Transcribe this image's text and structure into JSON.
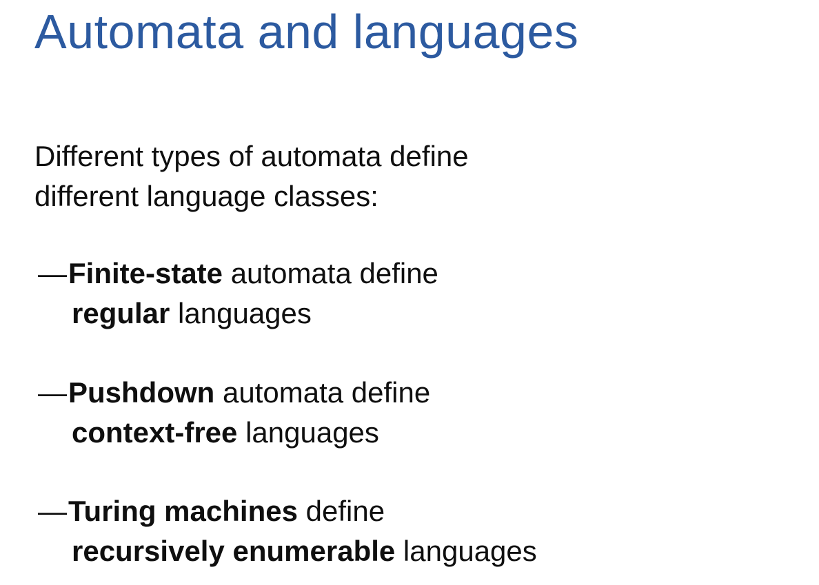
{
  "slide": {
    "title": "Automata and languages",
    "intro": {
      "line1": "Different types of automata define",
      "line2": "different language classes:"
    },
    "bullets": [
      {
        "dash": "—",
        "term": "Finite-state",
        "rest1": " automata define",
        "term2": "regular",
        "rest2": " languages"
      },
      {
        "dash": "—",
        "term": "Pushdown",
        "rest1": " automata define",
        "term2": "context-free",
        "rest2": " languages"
      },
      {
        "dash": "—",
        "term": "Turing machines",
        "rest1": " define",
        "term2": "recursively enumerable",
        "rest2": " languages"
      }
    ],
    "colors": {
      "title": "#2c5aa0",
      "text": "#0f0f0f",
      "background": "#ffffff"
    }
  }
}
